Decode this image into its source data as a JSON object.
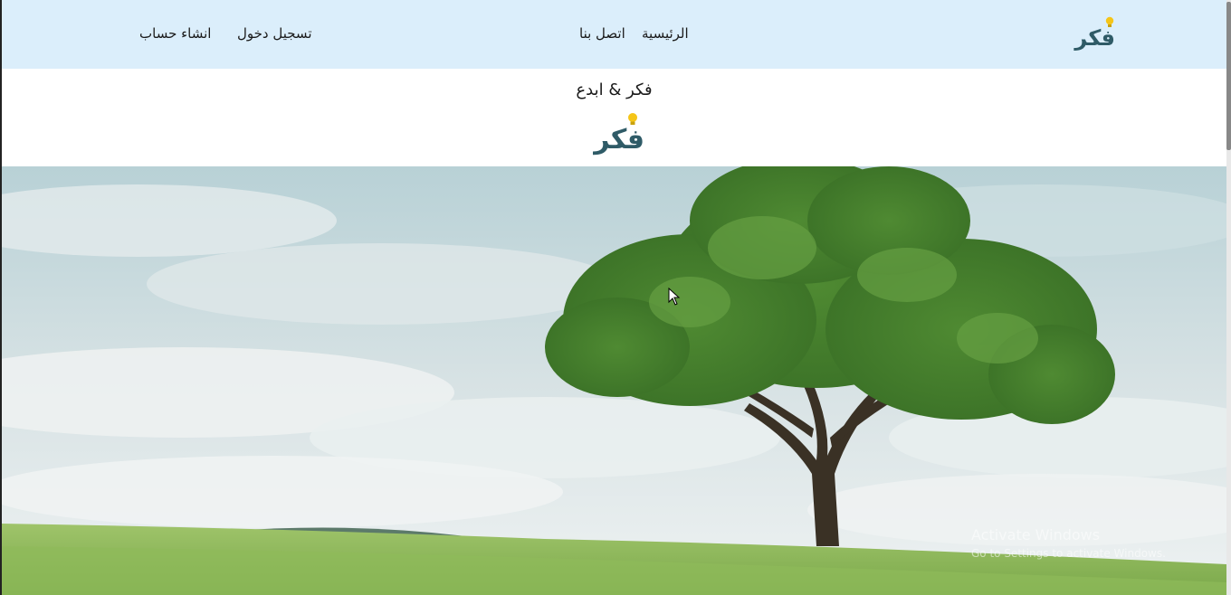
{
  "brand": {
    "name": "فكر"
  },
  "nav": {
    "home": "الرئيسية",
    "contact": "اتصل بنا",
    "login": "تسجيل دخول",
    "register": "انشاء حساب"
  },
  "hero_header": {
    "tagline": "فكر & ابدع",
    "logo_text": "فكر"
  },
  "watermark": {
    "line1": "Activate Windows",
    "line2": "Go to Settings to activate Windows."
  },
  "colors": {
    "navbar_bg": "#dbeefb",
    "brand_text": "#2f5b67",
    "bulb": "#f5c518"
  }
}
